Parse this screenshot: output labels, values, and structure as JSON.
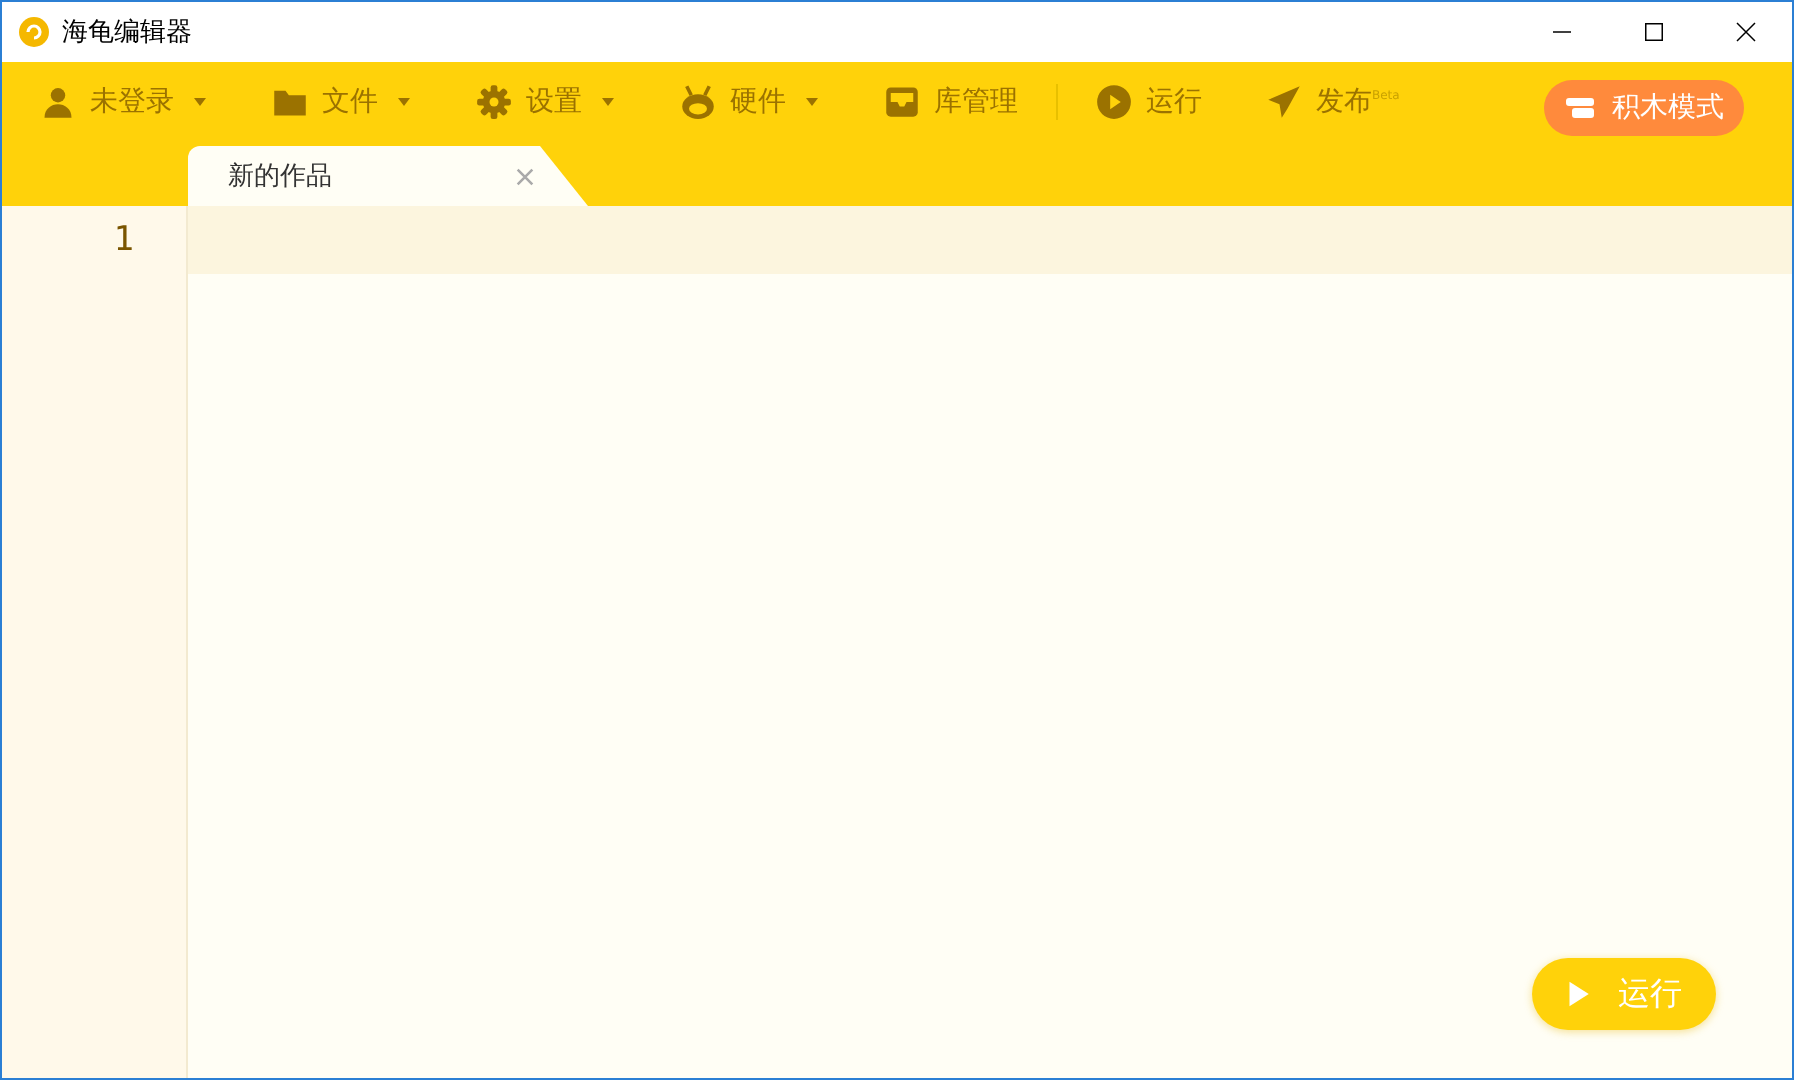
{
  "window": {
    "title": "海龟编辑器"
  },
  "menu": [
    {
      "label": "未登录",
      "kind": "user",
      "dropdown": true,
      "separator_after": false
    },
    {
      "label": "文件",
      "kind": "folder",
      "dropdown": true,
      "separator_after": false
    },
    {
      "label": "设置",
      "kind": "gear",
      "dropdown": true,
      "separator_after": false
    },
    {
      "label": "硬件",
      "kind": "robot",
      "dropdown": true,
      "separator_after": false
    },
    {
      "label": "库管理",
      "kind": "inbox",
      "dropdown": false,
      "separator_after": true
    },
    {
      "label": "运行",
      "kind": "play",
      "dropdown": false,
      "separator_after": false
    },
    {
      "label": "发布$^{Beta}$",
      "kind": "send",
      "dropdown": false,
      "separator_after": false
    }
  ],
  "mode_button": {
    "label": "积木模式"
  },
  "tabs": [
    {
      "label": "新的作品",
      "selected": true,
      "closable": true
    }
  ],
  "editor": {
    "lines": [
      {
        "number": "1",
        "current": true
      }
    ]
  },
  "run_button": {
    "label": "运行"
  }
}
